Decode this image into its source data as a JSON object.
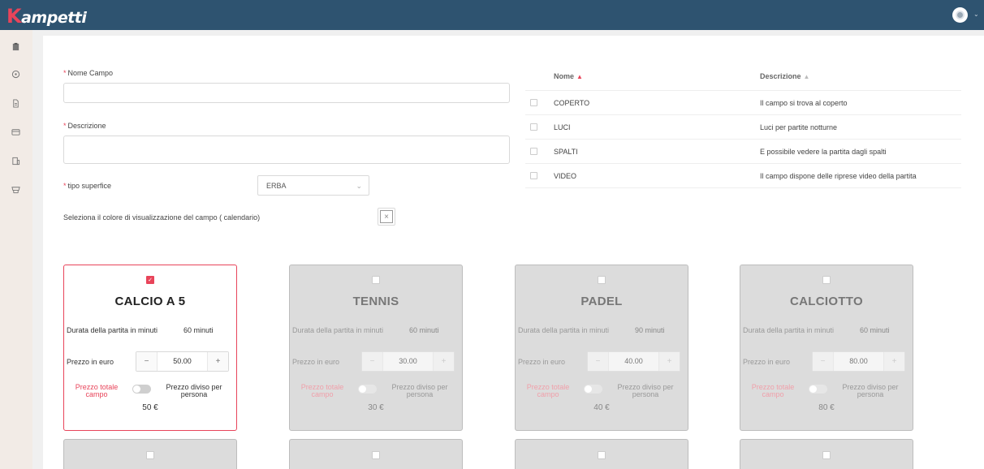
{
  "brand": {
    "name": "ampetti",
    "initial": "K"
  },
  "form": {
    "nome_campo_label": "Nome Campo",
    "nome_campo_value": "",
    "descrizione_label": "Descrizione",
    "descrizione_value": "",
    "superficie_label": "tipo superfice",
    "superficie_value": "ERBA",
    "colore_label": "Seleziona il colore di visualizzazione del campo ( calendario)"
  },
  "table": {
    "headers": [
      "Nome",
      "Descrizione"
    ],
    "rows": [
      {
        "nome": "COPERTO",
        "descrizione": "Il campo si trova al coperto",
        "checked": false
      },
      {
        "nome": "LUCI",
        "descrizione": "Luci per partite notturne",
        "checked": false
      },
      {
        "nome": "SPALTI",
        "descrizione": "E possibile vedere la partita dagli spalti",
        "checked": false
      },
      {
        "nome": "VIDEO",
        "descrizione": "Il campo dispone delle riprese video della partita",
        "checked": false
      }
    ]
  },
  "sports": [
    {
      "title": "CALCIO A 5",
      "active": true,
      "durata_label": "Durata della partita in minuti",
      "durata": "60 minuti",
      "prezzo_label": "Prezzo in euro",
      "prezzo": "50.00",
      "totale_label": "Prezzo totale campo",
      "diviso_label": "Prezzo diviso per persona",
      "amount": "50 €"
    },
    {
      "title": "TENNIS",
      "active": false,
      "durata_label": "Durata della partita in minuti",
      "durata": "60 minuti",
      "prezzo_label": "Prezzo in euro",
      "prezzo": "30.00",
      "totale_label": "Prezzo totale campo",
      "diviso_label": "Prezzo diviso per persona",
      "amount": "30 €"
    },
    {
      "title": "PADEL",
      "active": false,
      "durata_label": "Durata della partita in minuti",
      "durata": "90 minuti",
      "prezzo_label": "Prezzo in euro",
      "prezzo": "40.00",
      "totale_label": "Prezzo totale campo",
      "diviso_label": "Prezzo diviso per persona",
      "amount": "40 €"
    },
    {
      "title": "CALCIOTTO",
      "active": false,
      "durata_label": "Durata della partita in minuti",
      "durata": "60 minuti",
      "prezzo_label": "Prezzo in euro",
      "prezzo": "80.00",
      "totale_label": "Prezzo totale campo",
      "diviso_label": "Prezzo diviso per persona",
      "amount": "80 €"
    }
  ],
  "sidebar_icons": [
    "clipboard-icon",
    "ball-icon",
    "document-icon",
    "card-icon",
    "building-icon",
    "shop-icon"
  ],
  "colors": {
    "topbar": "#2e5370",
    "accent": "#e8445a",
    "sidebar": "#f2ebe6"
  }
}
